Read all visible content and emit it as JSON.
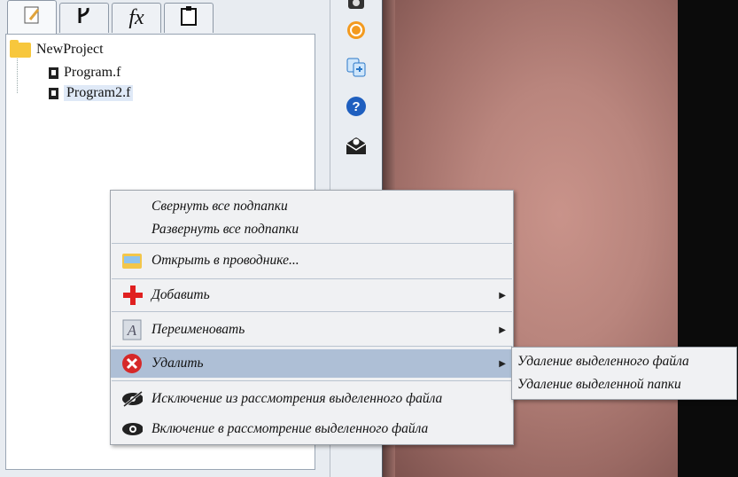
{
  "tabs": [
    {
      "icon": "notepad-icon"
    },
    {
      "icon": "branch-icon"
    },
    {
      "icon": "function-icon",
      "label": "fx"
    },
    {
      "icon": "clipboard-icon"
    }
  ],
  "tree": {
    "root": "NewProject",
    "files": [
      "Program.f",
      "Program2.f"
    ],
    "selected": "Program2.f"
  },
  "toolbar": [
    "camera-icon",
    "orange-circle-icon",
    "copy-icon",
    "help-icon",
    "mail-icon"
  ],
  "context_menu": {
    "items": [
      {
        "label": "Свернуть все подпапки"
      },
      {
        "label": "Развернуть все подпапки"
      },
      {
        "label": "Открыть в проводнике...",
        "icon": "explorer-icon"
      },
      {
        "label": "Добавить",
        "icon": "add-icon",
        "submenu": true
      },
      {
        "label": "Переименовать",
        "icon": "rename-icon",
        "submenu": true
      },
      {
        "label": "Удалить",
        "icon": "delete-icon",
        "submenu": true,
        "highlighted": true
      },
      {
        "label": "Исключение из рассмотрения выделенного файла",
        "icon": "eye-hidden-icon"
      },
      {
        "label": "Включение в рассмотрение выделенного файла",
        "icon": "eye-icon"
      }
    ]
  },
  "submenu": {
    "items": [
      "Удаление выделенного файла",
      "Удаление выделенной папки"
    ]
  },
  "colors": {
    "highlight": "#aebfd6",
    "folder": "#f7c73d",
    "delete": "#d62828",
    "add": "#e02020"
  }
}
